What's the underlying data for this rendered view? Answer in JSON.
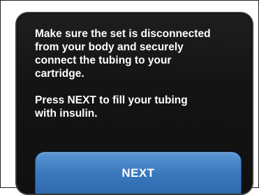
{
  "screen": {
    "message_line_1": "Make sure the set is disconnected\nfrom your body and securely\nconnect the tubing to your\ncartridge.",
    "message_line_2": "Press NEXT to fill your tubing\nwith insulin."
  },
  "actions": {
    "next_label": "NEXT"
  },
  "colors": {
    "screen_background": "#141414",
    "text": "#ffffff",
    "button": "#3a78bc"
  }
}
